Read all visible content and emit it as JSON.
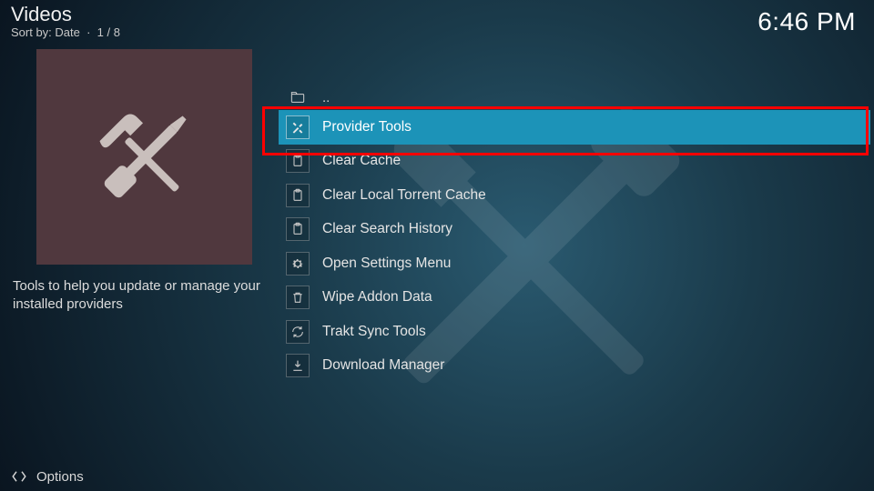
{
  "header": {
    "title": "Videos",
    "sort_label": "Sort by:",
    "sort_value": "Date",
    "position": "1 / 8"
  },
  "clock": "6:46 PM",
  "sidebar": {
    "description": "Tools to help you update or manage your installed providers"
  },
  "list": {
    "parent_label": "..",
    "items": [
      {
        "label": "Provider Tools",
        "icon": "tools",
        "selected": true
      },
      {
        "label": "Clear Cache",
        "icon": "clipboard",
        "selected": false
      },
      {
        "label": "Clear Local Torrent Cache",
        "icon": "clipboard",
        "selected": false
      },
      {
        "label": "Clear Search History",
        "icon": "clipboard",
        "selected": false
      },
      {
        "label": "Open Settings Menu",
        "icon": "gear",
        "selected": false
      },
      {
        "label": "Wipe Addon Data",
        "icon": "trash",
        "selected": false
      },
      {
        "label": "Trakt Sync Tools",
        "icon": "sync",
        "selected": false
      },
      {
        "label": "Download Manager",
        "icon": "download",
        "selected": false
      }
    ]
  },
  "footer": {
    "options_label": "Options"
  },
  "annotation": {
    "highlighted_item": "Provider Tools"
  }
}
